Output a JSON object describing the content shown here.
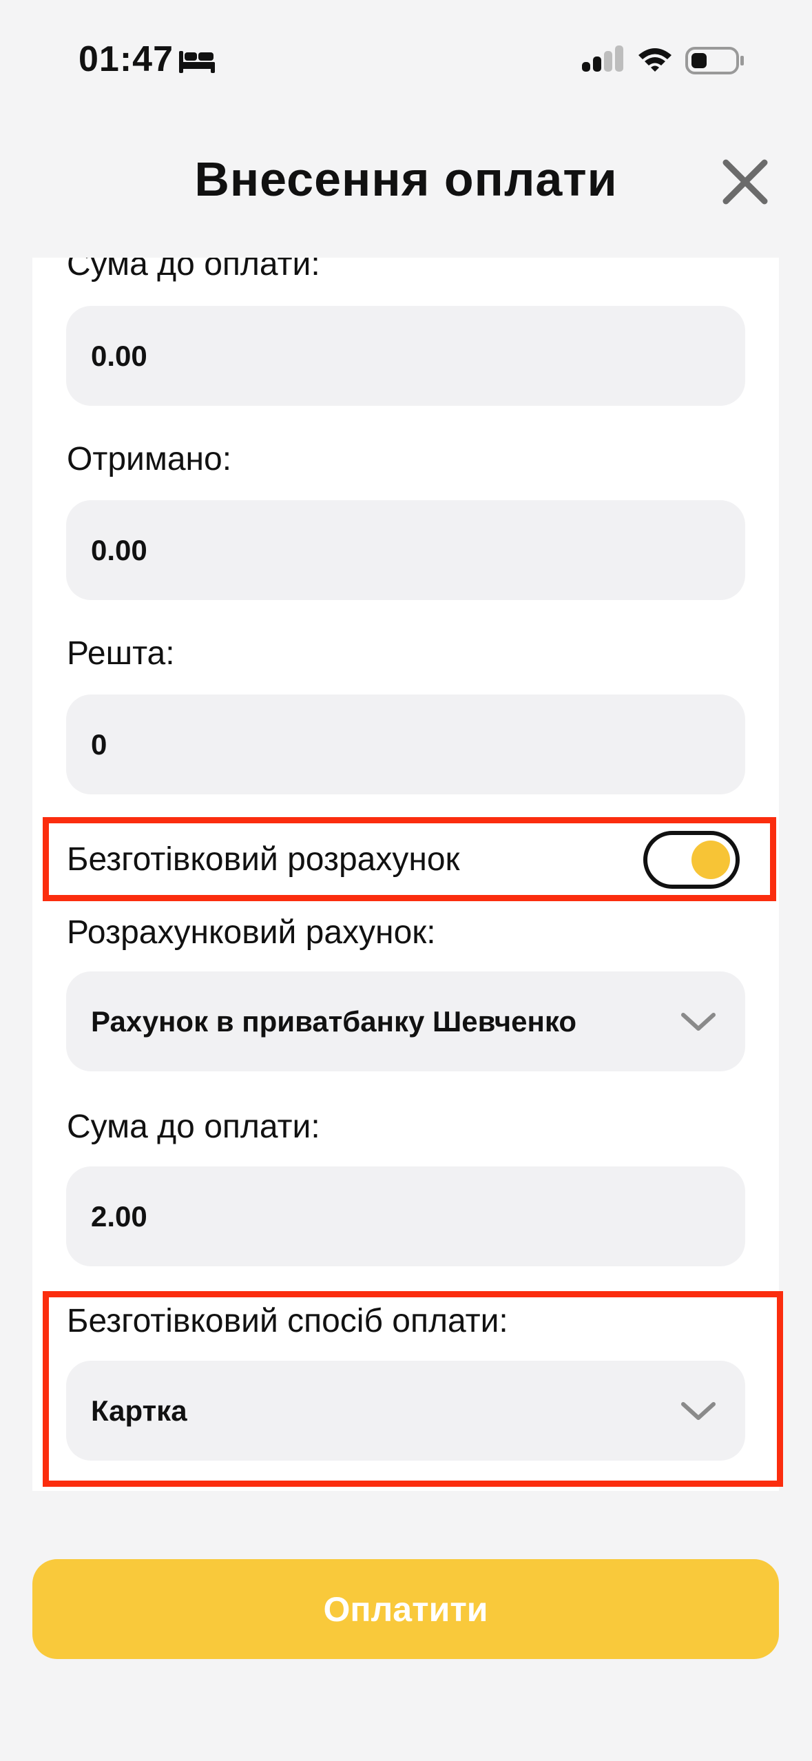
{
  "status_bar": {
    "time": "01:47",
    "icons": [
      "sleep-icon",
      "cellular-signal-icon",
      "wifi-icon",
      "battery-icon"
    ]
  },
  "header": {
    "title": "Внесення оплати",
    "close_icon": "close-icon"
  },
  "form": {
    "amount_due_label": "Сума до оплати:",
    "amount_due_value": "0.00",
    "received_label": "Отримано:",
    "received_value": "0.00",
    "change_label": "Решта:",
    "change_value": "0",
    "cashless_toggle_label": "Безготівковий розрахунок",
    "cashless_toggle_on": true,
    "settlement_account_label": "Розрахунковий рахунок:",
    "settlement_account_value": "Рахунок в приватбанку Шевченко",
    "cashless_amount_label": "Сума до оплати:",
    "cashless_amount_value": "2.00",
    "cashless_method_label": "Безготівковий спосіб оплати:",
    "cashless_method_value": "Картка"
  },
  "actions": {
    "pay_label": "Оплатити"
  },
  "colors": {
    "accent": "#f9c93b",
    "highlight": "#fb2d0e",
    "field_bg": "#f1f1f3",
    "page_bg": "#f4f4f5"
  }
}
